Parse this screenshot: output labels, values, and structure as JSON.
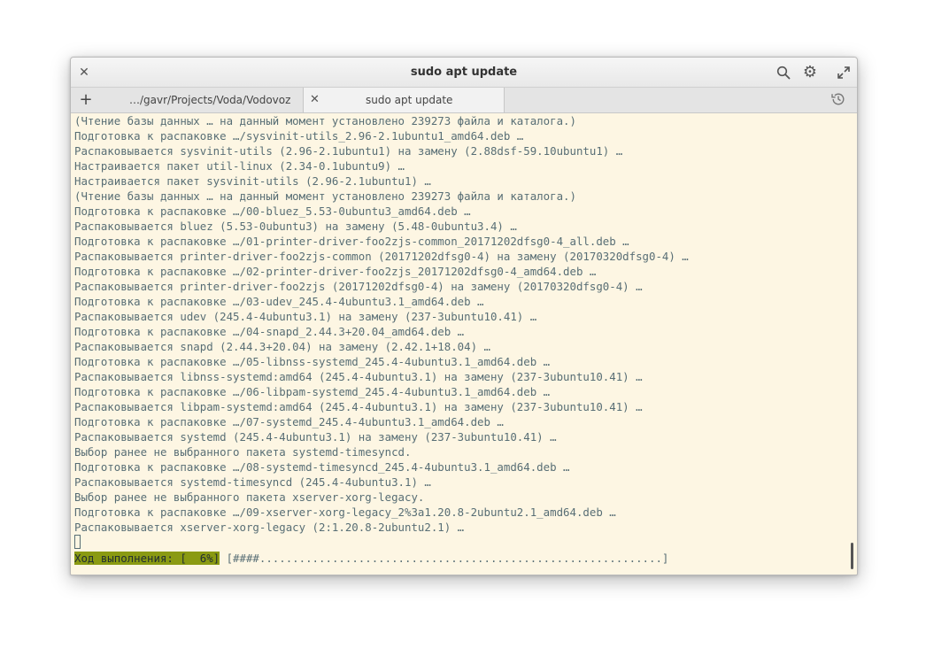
{
  "window": {
    "title": "sudo apt update"
  },
  "tabs": [
    {
      "label": "…/gavr/Projects/Voda/Vodovoz"
    },
    {
      "label": "sudo apt update"
    }
  ],
  "icons": {
    "close": "close-icon",
    "search": "search-icon",
    "settings": "gear-icon",
    "maximize": "maximize-icon",
    "add_tab": "plus-icon",
    "history": "history-icon"
  },
  "terminal": {
    "lines": [
      "(Чтение базы данных … на данный момент установлено 239273 файла и каталога.)",
      "Подготовка к распаковке …/sysvinit-utils_2.96-2.1ubuntu1_amd64.deb …",
      "Распаковывается sysvinit-utils (2.96-2.1ubuntu1) на замену (2.88dsf-59.10ubuntu1) …",
      "Настраивается пакет util-linux (2.34-0.1ubuntu9) …",
      "Настраивается пакет sysvinit-utils (2.96-2.1ubuntu1) …",
      "(Чтение базы данных … на данный момент установлено 239273 файла и каталога.)",
      "Подготовка к распаковке …/00-bluez_5.53-0ubuntu3_amd64.deb …",
      "Распаковывается bluez (5.53-0ubuntu3) на замену (5.48-0ubuntu3.4) …",
      "Подготовка к распаковке …/01-printer-driver-foo2zjs-common_20171202dfsg0-4_all.deb …",
      "Распаковывается printer-driver-foo2zjs-common (20171202dfsg0-4) на замену (20170320dfsg0-4) …",
      "Подготовка к распаковке …/02-printer-driver-foo2zjs_20171202dfsg0-4_amd64.deb …",
      "Распаковывается printer-driver-foo2zjs (20171202dfsg0-4) на замену (20170320dfsg0-4) …",
      "Подготовка к распаковке …/03-udev_245.4-4ubuntu3.1_amd64.deb …",
      "Распаковывается udev (245.4-4ubuntu3.1) на замену (237-3ubuntu10.41) …",
      "Подготовка к распаковке …/04-snapd_2.44.3+20.04_amd64.deb …",
      "Распаковывается snapd (2.44.3+20.04) на замену (2.42.1+18.04) …",
      "Подготовка к распаковке …/05-libnss-systemd_245.4-4ubuntu3.1_amd64.deb …",
      "Распаковывается libnss-systemd:amd64 (245.4-4ubuntu3.1) на замену (237-3ubuntu10.41) …",
      "Подготовка к распаковке …/06-libpam-systemd_245.4-4ubuntu3.1_amd64.deb …",
      "Распаковывается libpam-systemd:amd64 (245.4-4ubuntu3.1) на замену (237-3ubuntu10.41) …",
      "Подготовка к распаковке …/07-systemd_245.4-4ubuntu3.1_amd64.deb …",
      "Распаковывается systemd (245.4-4ubuntu3.1) на замену (237-3ubuntu10.41) …",
      "Выбор ранее не выбранного пакета systemd-timesyncd.",
      "Подготовка к распаковке …/08-systemd-timesyncd_245.4-4ubuntu3.1_amd64.deb …",
      "Распаковывается systemd-timesyncd (245.4-4ubuntu3.1) …",
      "Выбор ранее не выбранного пакета xserver-xorg-legacy.",
      "Подготовка к распаковке …/09-xserver-xorg-legacy_2%3a1.20.8-2ubuntu2.1_amd64.deb …",
      "Распаковывается xserver-xorg-legacy (2:1.20.8-2ubuntu2.1) …"
    ],
    "progress": {
      "label": "Ход выполнения: [  6%]",
      "bar": " [####.............................................................]",
      "percent": 6
    }
  },
  "colors": {
    "terminal_bg": "#fdf6e3",
    "terminal_fg": "#586e75",
    "progress_highlight": "#8a9a12"
  }
}
